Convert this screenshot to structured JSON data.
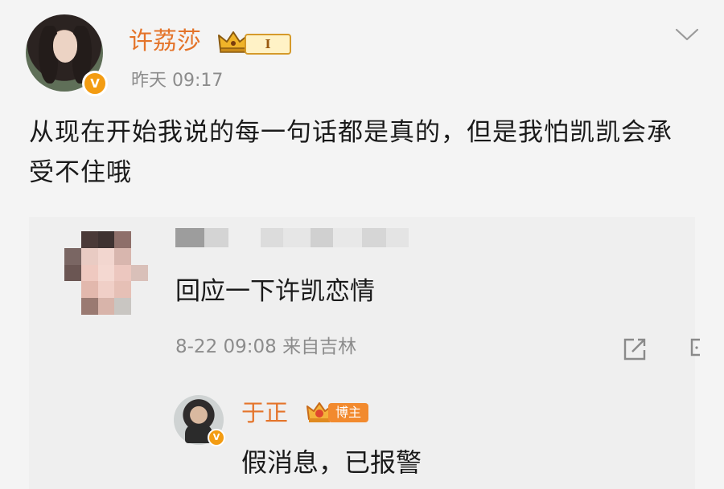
{
  "post": {
    "author_name": "许荔莎",
    "level_badge": "I",
    "time": "昨天 09:17",
    "content": "从现在开始我说的每一句话都是真的，但是我怕凯凯会承受不住哦",
    "author_icon": "avatar",
    "verified_icon": "verified-v-icon",
    "verified_mark": "V",
    "more_icon": "chevron-down-icon"
  },
  "comment": {
    "author_name_blurred": true,
    "text": "回应一下许凯恋情",
    "meta": "8-22 09:08 来自吉林",
    "share_icon": "share-icon",
    "comment_icon": "comment-icon"
  },
  "reply": {
    "author_name": "于正",
    "role_badge": "博主",
    "text": "假消息，已报警",
    "verified_mark": "V"
  },
  "colors": {
    "name": "#e4742a",
    "meta": "#8c8c8c",
    "badge_orange": "#f39c12",
    "card_bg": "#efefef",
    "page_bg": "#f4f4f4"
  }
}
